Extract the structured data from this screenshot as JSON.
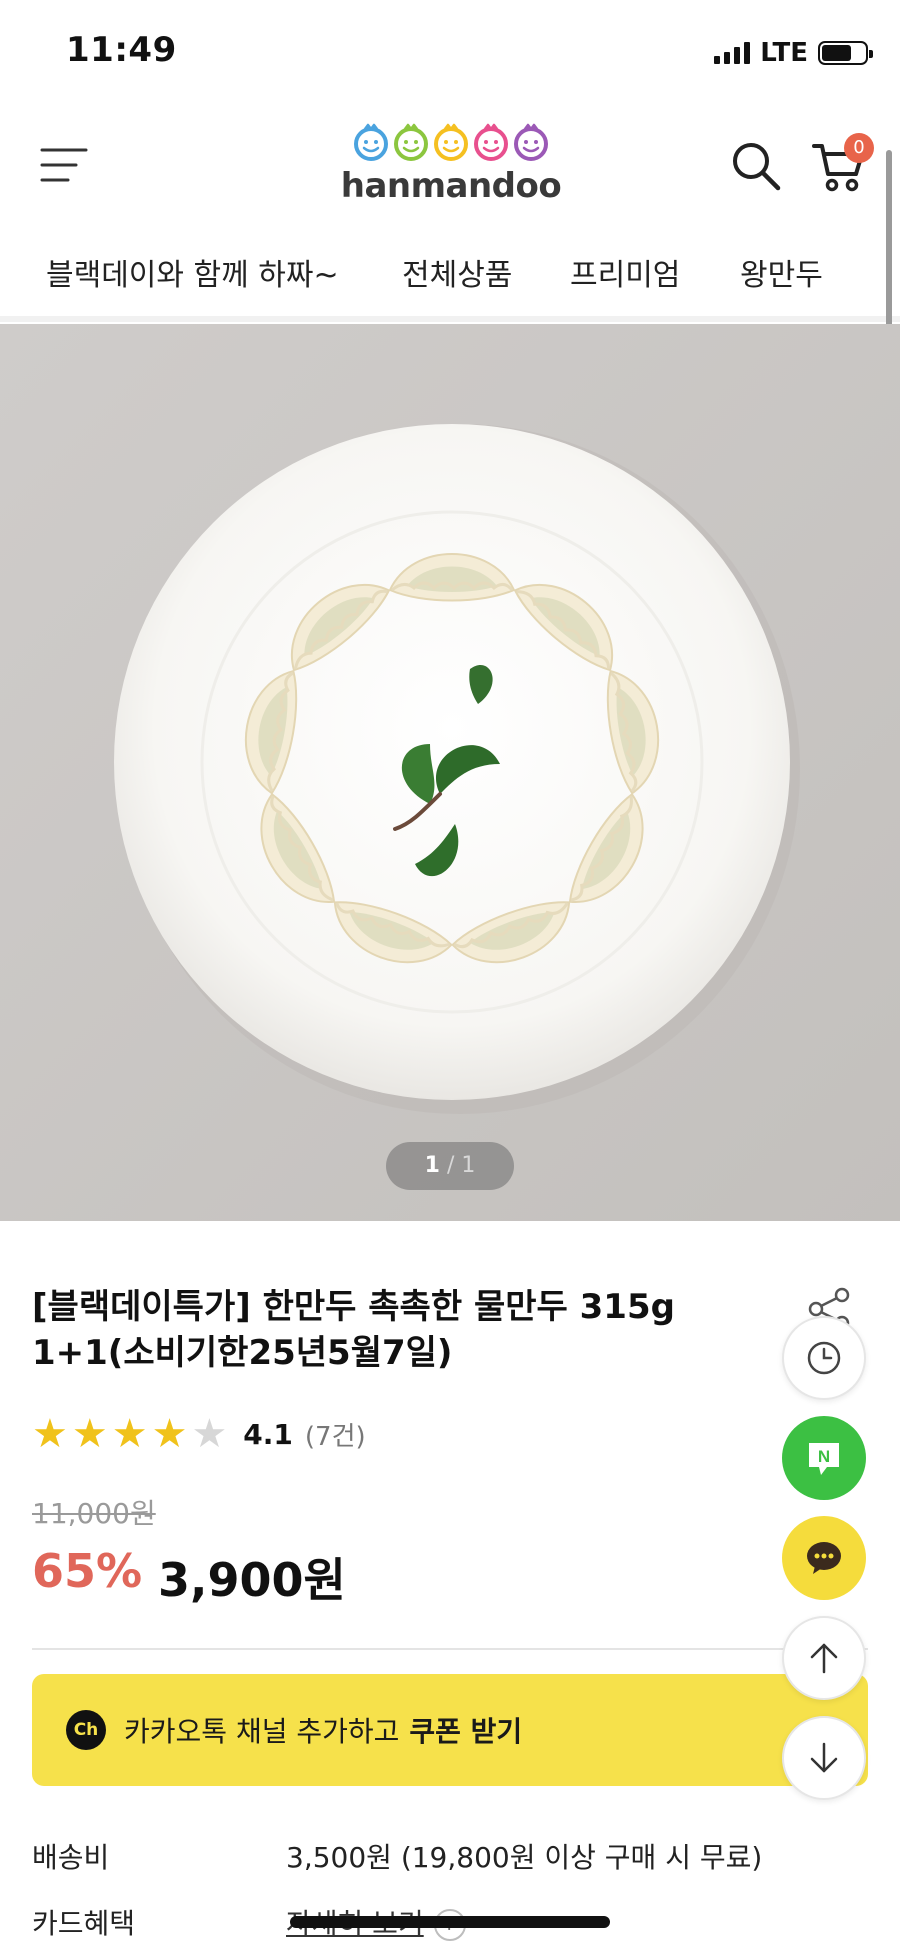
{
  "status_bar": {
    "time": "11:49",
    "network": "LTE"
  },
  "header": {
    "menu_icon": "hamburger-menu-icon",
    "logo_text": "hanmandoo",
    "logo_face_colors": [
      "#4aa3df",
      "#8cc63f",
      "#f5c021",
      "#e8508e",
      "#9b59b6"
    ],
    "search_icon": "search-icon",
    "cart_icon": "cart-icon",
    "cart_count": "0"
  },
  "category_nav": {
    "items": [
      {
        "label": "블랙데이와 함께 하짜~"
      },
      {
        "label": "전체상품"
      },
      {
        "label": "프리미엄"
      },
      {
        "label": "왕만두"
      }
    ]
  },
  "gallery": {
    "image": "product-photo-steamed-dumplings-on-plate",
    "current": "1",
    "separator": "/",
    "total": "1"
  },
  "product": {
    "title": "[블랙데이특가] 한만두 촉촉한 물만두 315g 1+1(소비기한25년5월7일)",
    "rating": {
      "stars_filled": 4,
      "stars_total": 5,
      "value": "4.1",
      "count": "(7건)"
    },
    "original_price": "11,000원",
    "discount_rate": "65%",
    "sale_price": "3,900원"
  },
  "kakao_banner": {
    "icon_text": "Ch",
    "text": "카카오톡 채널 추가하고",
    "strong": "쿠폰 받기",
    "color": "#f6e14b"
  },
  "info": {
    "shipping_label": "배송비",
    "shipping_value": "3,500원 (19,800원 이상 구매 시 무료)",
    "card_label": "카드혜택",
    "card_value": "자세히 보기",
    "help_text": "?"
  },
  "floating_buttons": [
    "recent-view-clock-icon",
    "naver-talk-icon",
    "kakao-talk-icon",
    "scroll-top-arrow-icon",
    "scroll-bottom-arrow-icon"
  ],
  "naver_letter": "N",
  "colors": {
    "discount": "#e0675a",
    "star": "#f0c21b",
    "naver": "#3cc043",
    "kakao": "#f5dc3c"
  }
}
